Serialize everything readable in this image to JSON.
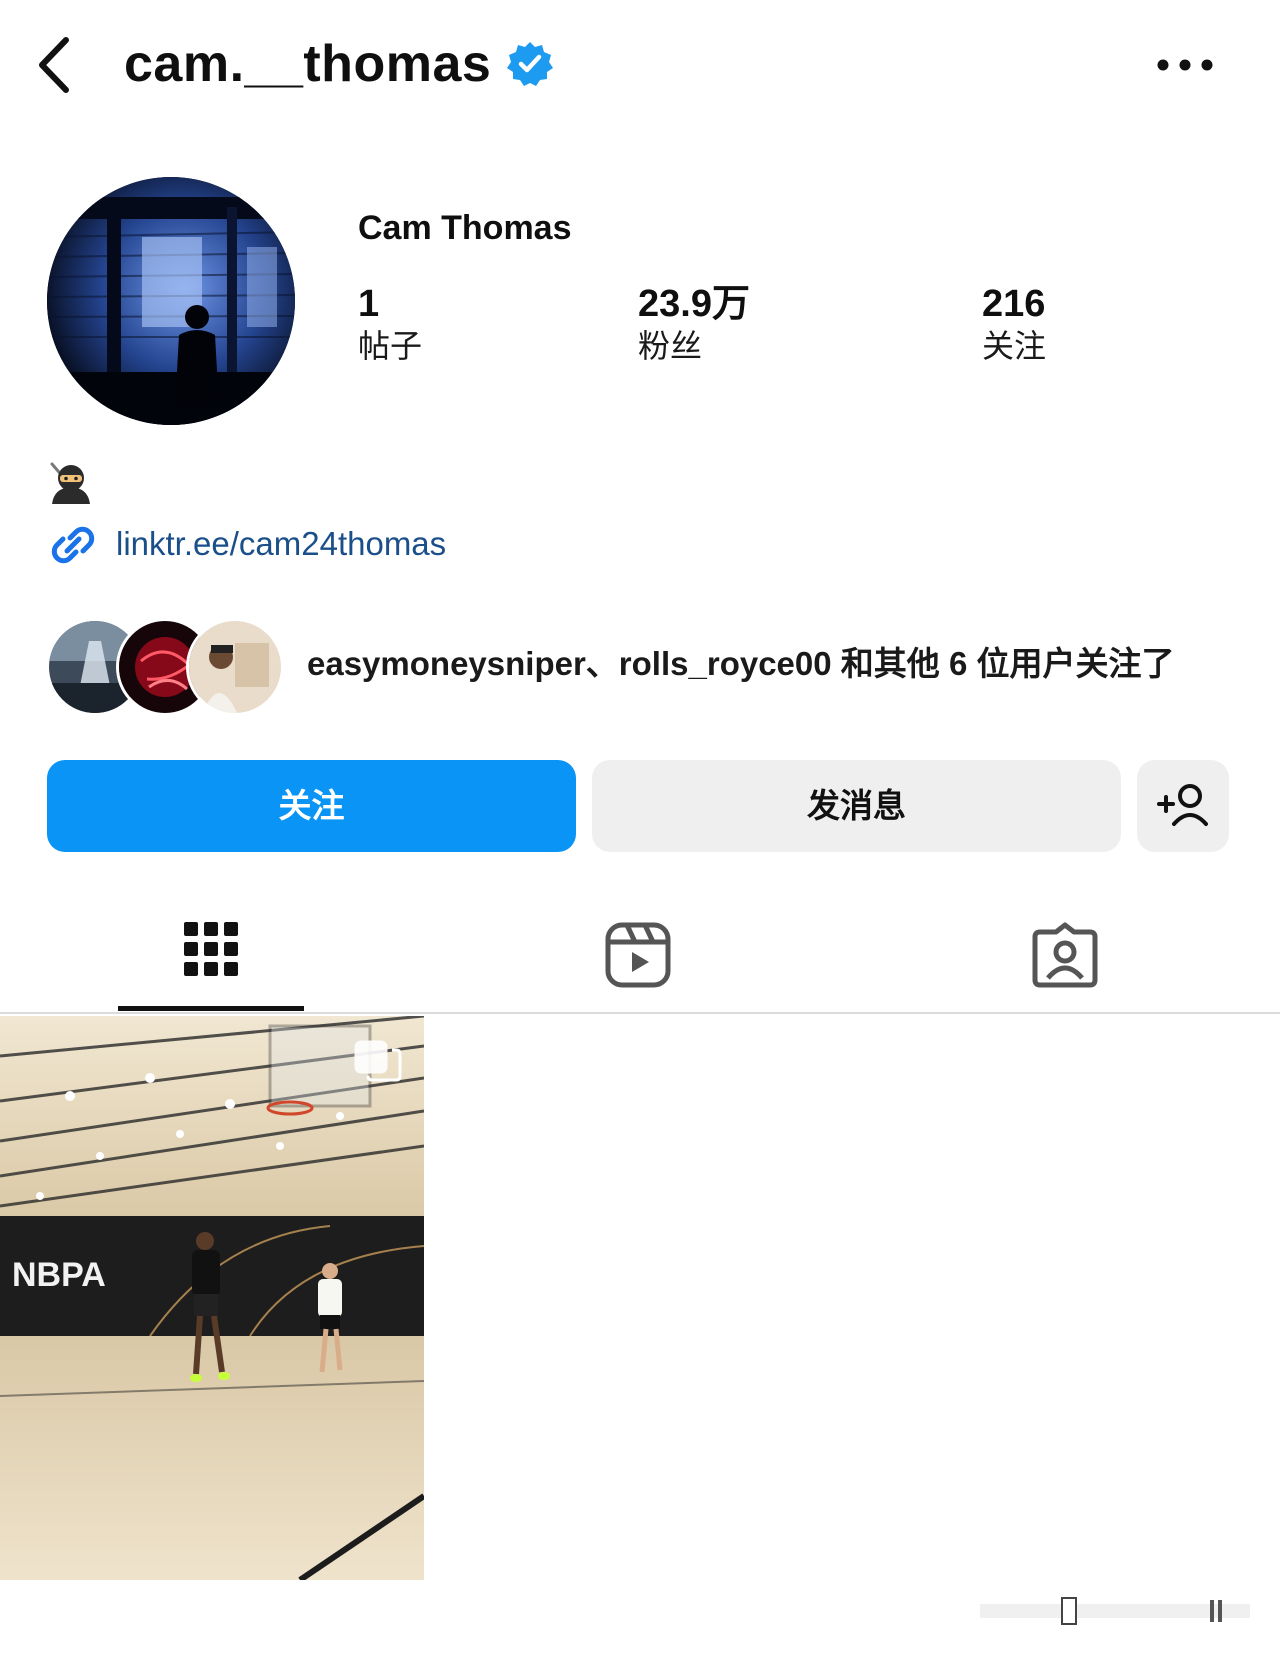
{
  "header": {
    "username": "cam.__thomas",
    "verified": true,
    "back_icon": "chevron-left-icon",
    "more_icon": "more-horizontal-icon"
  },
  "profile": {
    "display_name": "Cam Thomas",
    "stats": [
      {
        "value": "1",
        "label": "帖子"
      },
      {
        "value": "23.9万",
        "label": "粉丝"
      },
      {
        "value": "216",
        "label": "关注"
      }
    ]
  },
  "bio": {
    "emoji": "ninja-emoji",
    "link": "linktr.ee/cam24thomas"
  },
  "followed_by": {
    "text": "easymoneysniper、rolls_royce00 和其他 6 位用户关注了"
  },
  "actions": {
    "follow_label": "关注",
    "message_label": "发消息",
    "add_user_icon": "add-person-icon"
  },
  "tabs": [
    {
      "icon": "grid-icon",
      "active": true
    },
    {
      "icon": "reels-icon",
      "active": false
    },
    {
      "icon": "tagged-icon",
      "active": false
    }
  ],
  "posts": [
    {
      "overlay_text": "NBPA",
      "multi_image": true
    }
  ],
  "colors": {
    "accent": "#0a95f6",
    "verified": "#1d9bf0",
    "link": "#1b4f8a",
    "secondary_button": "#efefef"
  }
}
